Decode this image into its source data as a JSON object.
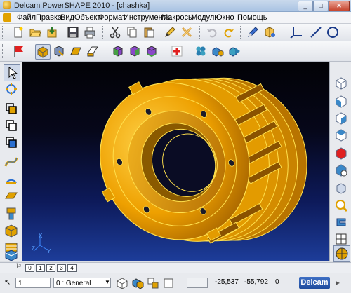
{
  "window": {
    "title": "Delcam PowerSHAPE 2010 - [chashka]",
    "min": "_",
    "max": "□",
    "close": "✕"
  },
  "menu": [
    "Файл",
    "Правка",
    "Вид",
    "Объект",
    "Формат",
    "Инструменты",
    "Макросы",
    "Модули",
    "Окно",
    "Помощь"
  ],
  "toolbar_main": [
    "new-icon",
    "open-icon",
    "import-icon",
    "save-icon",
    "print-icon",
    "cut-icon",
    "copy-icon",
    "paste-icon",
    "edit-icon",
    "delete-icon",
    "undo-icon",
    "redo-icon",
    "pen-icon",
    "paint-icon",
    "axis-icon",
    "line-icon",
    "circle-icon"
  ],
  "toolbar_secondary": [
    "flag-icon",
    "view-iso-icon",
    "view-rotate-icon",
    "view-section-icon",
    "view-plane-icon",
    "shade-icon",
    "shade-edges-icon",
    "shade-half-icon",
    "add-red-icon",
    "cluster-icon",
    "cube-blue-icon",
    "cube-arrow-icon"
  ],
  "left_tools": [
    "select-arrow-icon",
    "transform-icon",
    "wireframe-icon",
    "surface-icon",
    "solid-icon",
    "curve-icon",
    "arc-icon",
    "workplane-icon",
    "dimension-icon",
    "block-icon",
    "feature-icon",
    "drawing-icon",
    "assembly-icon"
  ],
  "right_tools": [
    "view-top-icon",
    "view-front-icon",
    "view-right-icon",
    "view-back-icon",
    "view-iso1-icon",
    "view-iso2-icon",
    "view-iso3-icon",
    "zoom-icon",
    "spin-icon",
    "pan-icon",
    "ruler-icon",
    "grid-icon",
    "sphere-icon"
  ],
  "axes": {
    "x": "X",
    "y": "Y",
    "z": "Z"
  },
  "layers": [
    "0",
    "1",
    "2",
    "3",
    "4"
  ],
  "status": {
    "layer_value": "1",
    "level_value": "0 : General",
    "x_value": "-25,537",
    "y_value": "-55,792",
    "z_value": "0",
    "brand": "Delcam"
  },
  "colors": {
    "part": "#f0a400",
    "edge": "#ffe04d",
    "viewport_top": "#020206",
    "viewport_bottom": "#1d3d9a"
  }
}
